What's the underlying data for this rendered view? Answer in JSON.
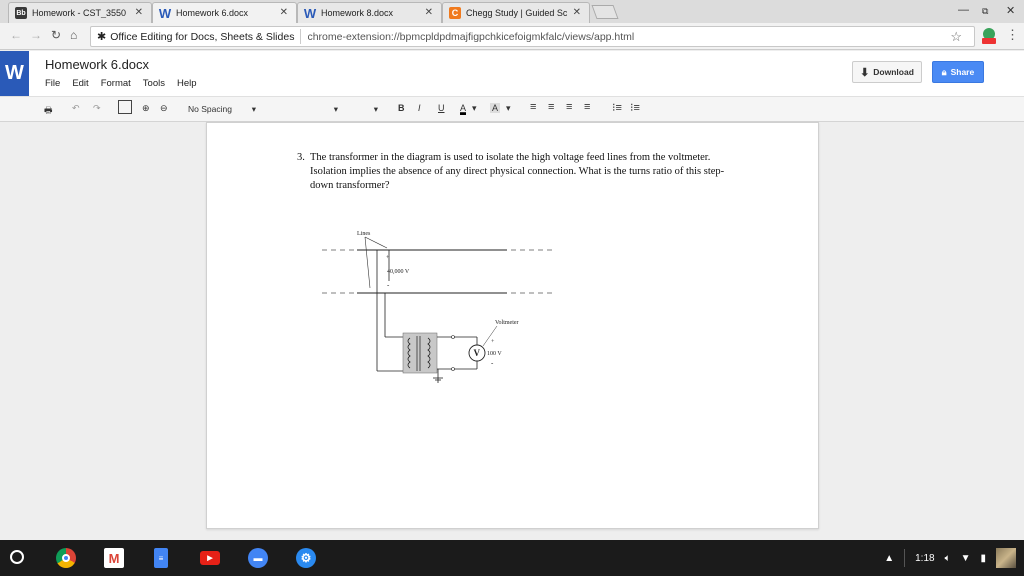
{
  "tabs": [
    {
      "title": "Homework - CST_3550",
      "favicon": "Bb",
      "favicon_color": "#3a3a3a",
      "active": false
    },
    {
      "title": "Homework 6.docx",
      "favicon": "W",
      "favicon_color": "#2a5ab8",
      "active": true
    },
    {
      "title": "Homework 8.docx",
      "favicon": "W",
      "favicon_color": "#2a5ab8",
      "active": false
    },
    {
      "title": "Chegg Study | Guided Sc",
      "favicon": "C",
      "favicon_color": "#f07a1e",
      "active": false
    }
  ],
  "address": {
    "extension_label": "Office Editing for Docs, Sheets & Slides",
    "url": "chrome-extension://bpmcpldpdmajfigpchkicefoigmkfalc/views/app.html"
  },
  "app": {
    "doc_title": "Homework 6.docx",
    "logo": "W",
    "menu": [
      "File",
      "Edit",
      "Format",
      "Tools",
      "Help"
    ],
    "download_label": "Download",
    "share_label": "Share"
  },
  "format": {
    "style": "No Spacing",
    "bold": "B",
    "italic": "I",
    "underline": "U",
    "text_color": "A",
    "highlight": "A"
  },
  "document": {
    "question_number": "3.",
    "question_text": "The transformer in the diagram is used to isolate the high voltage feed lines from the voltmeter. Isolation implies the absence of any direct physical connection. What is the turns ratio of this step-down transformer?",
    "diagram": {
      "lines_label": "Lines",
      "plus_top": "+",
      "high_voltage": "40,000 V",
      "minus_top": "-",
      "voltmeter_label": "Voltmeter",
      "plus_meter": "+",
      "meter_letter": "V",
      "low_voltage": "100 V",
      "minus_meter": "-"
    }
  },
  "shelf": {
    "time": "1:18"
  }
}
